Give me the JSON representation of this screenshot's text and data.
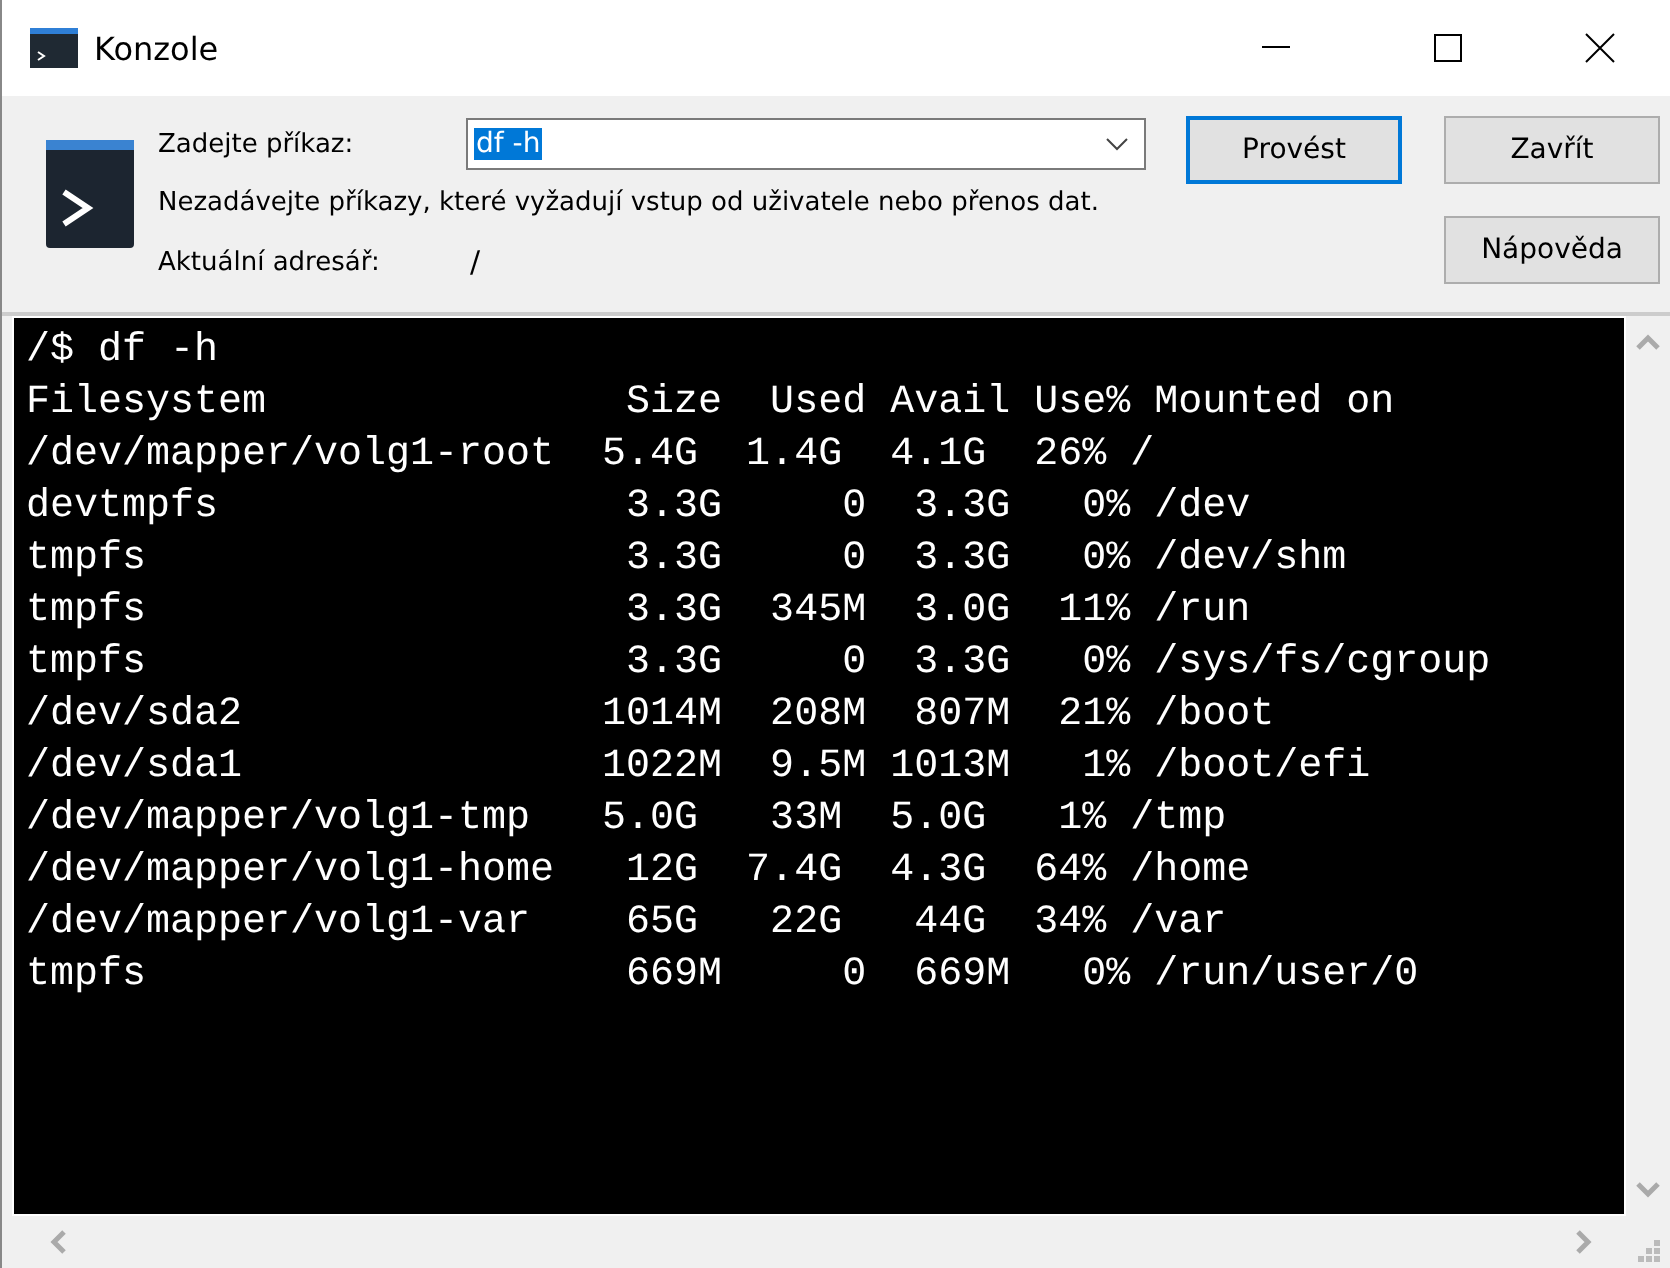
{
  "window": {
    "title": "Konzole"
  },
  "command": {
    "label": "Zadejte příkaz:",
    "value": "df -h",
    "value_selected": true
  },
  "hint": "Nezadávejte příkazy, které vyžadují vstup od uživatele nebo přenos dat.",
  "directory": {
    "label": "Aktuální adresář:",
    "value": "/"
  },
  "buttons": [
    {
      "label": "Provést",
      "default": true
    },
    {
      "label": "Zavřít",
      "default": false
    },
    {
      "label": "Nápověda",
      "default": false
    }
  ],
  "output": [
    "/$ df -h",
    "Filesystem               Size  Used Avail Use% Mounted on",
    "/dev/mapper/volg1-root  5.4G  1.4G  4.1G  26% /",
    "devtmpfs                 3.3G     0  3.3G   0% /dev",
    "tmpfs                    3.3G     0  3.3G   0% /dev/shm",
    "tmpfs                    3.3G  345M  3.0G  11% /run",
    "tmpfs                    3.3G     0  3.3G   0% /sys/fs/cgroup",
    "/dev/sda2               1014M  208M  807M  21% /boot",
    "/dev/sda1               1022M  9.5M 1013M   1% /boot/efi",
    "/dev/mapper/volg1-tmp   5.0G   33M  5.0G   1% /tmp",
    "/dev/mapper/volg1-home   12G  7.4G  4.3G  64% /home",
    "/dev/mapper/volg1-var    65G   22G   44G  34% /var",
    "tmpfs                    669M     0  669M   0% /run/user/0"
  ]
}
